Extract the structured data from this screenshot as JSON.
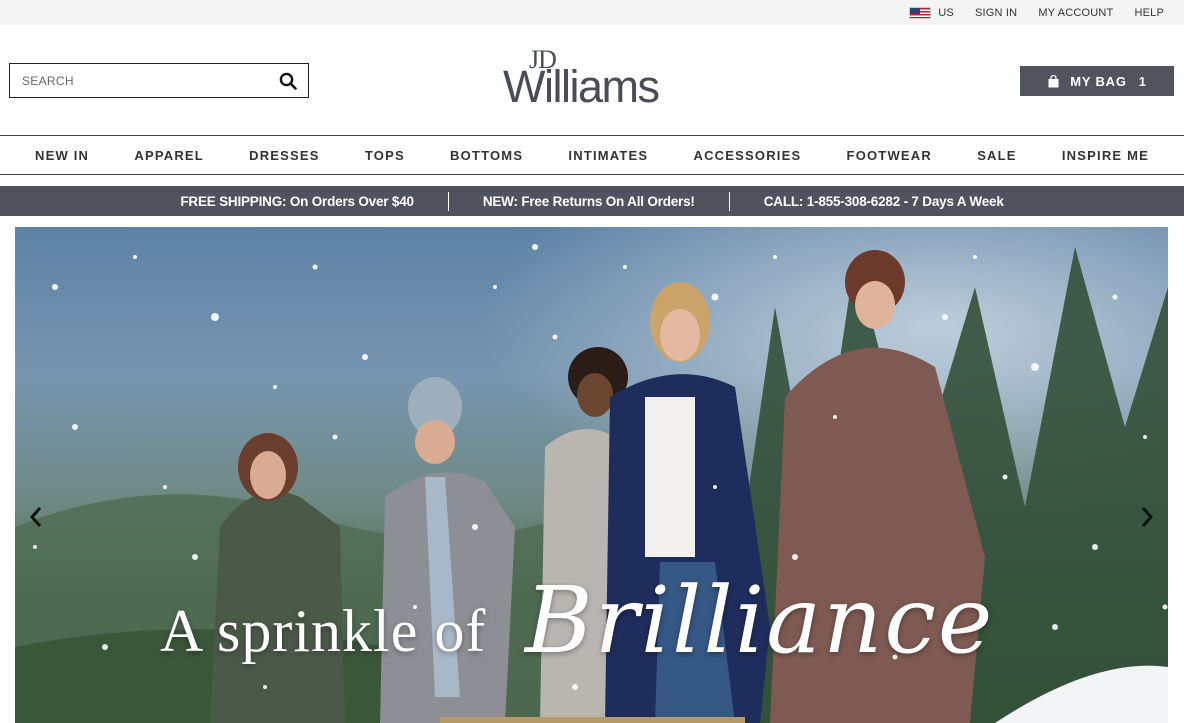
{
  "utility": {
    "locale_code": "US",
    "flag_icon": "us-flag-icon",
    "sign_in": "SIGN IN",
    "my_account": "MY ACCOUNT",
    "help": "HELP"
  },
  "header": {
    "search_placeholder": "SEARCH",
    "search_icon": "search-icon",
    "logo_jd": "JD",
    "logo_name": "Williams",
    "bag_label": "MY BAG",
    "bag_count": "1",
    "bag_icon": "shopping-bag-icon"
  },
  "nav": {
    "items": [
      "NEW IN",
      "APPAREL",
      "DRESSES",
      "TOPS",
      "BOTTOMS",
      "INTIMATES",
      "ACCESSORIES",
      "FOOTWEAR",
      "SALE",
      "INSPIRE ME"
    ]
  },
  "promo": {
    "messages": [
      "FREE SHIPPING: On Orders Over $40",
      "NEW: Free Returns On All Orders!",
      "CALL: 1-855-308-6282 - 7 Days A Week"
    ],
    "background": "#50525e"
  },
  "hero": {
    "headline_a": "A sprinkle of",
    "headline_b": "Brilliance",
    "prev_icon": "chevron-left-icon",
    "next_icon": "chevron-right-icon"
  },
  "colors": {
    "brand_gray": "#51535d",
    "logo_color": "#4a4c58"
  }
}
